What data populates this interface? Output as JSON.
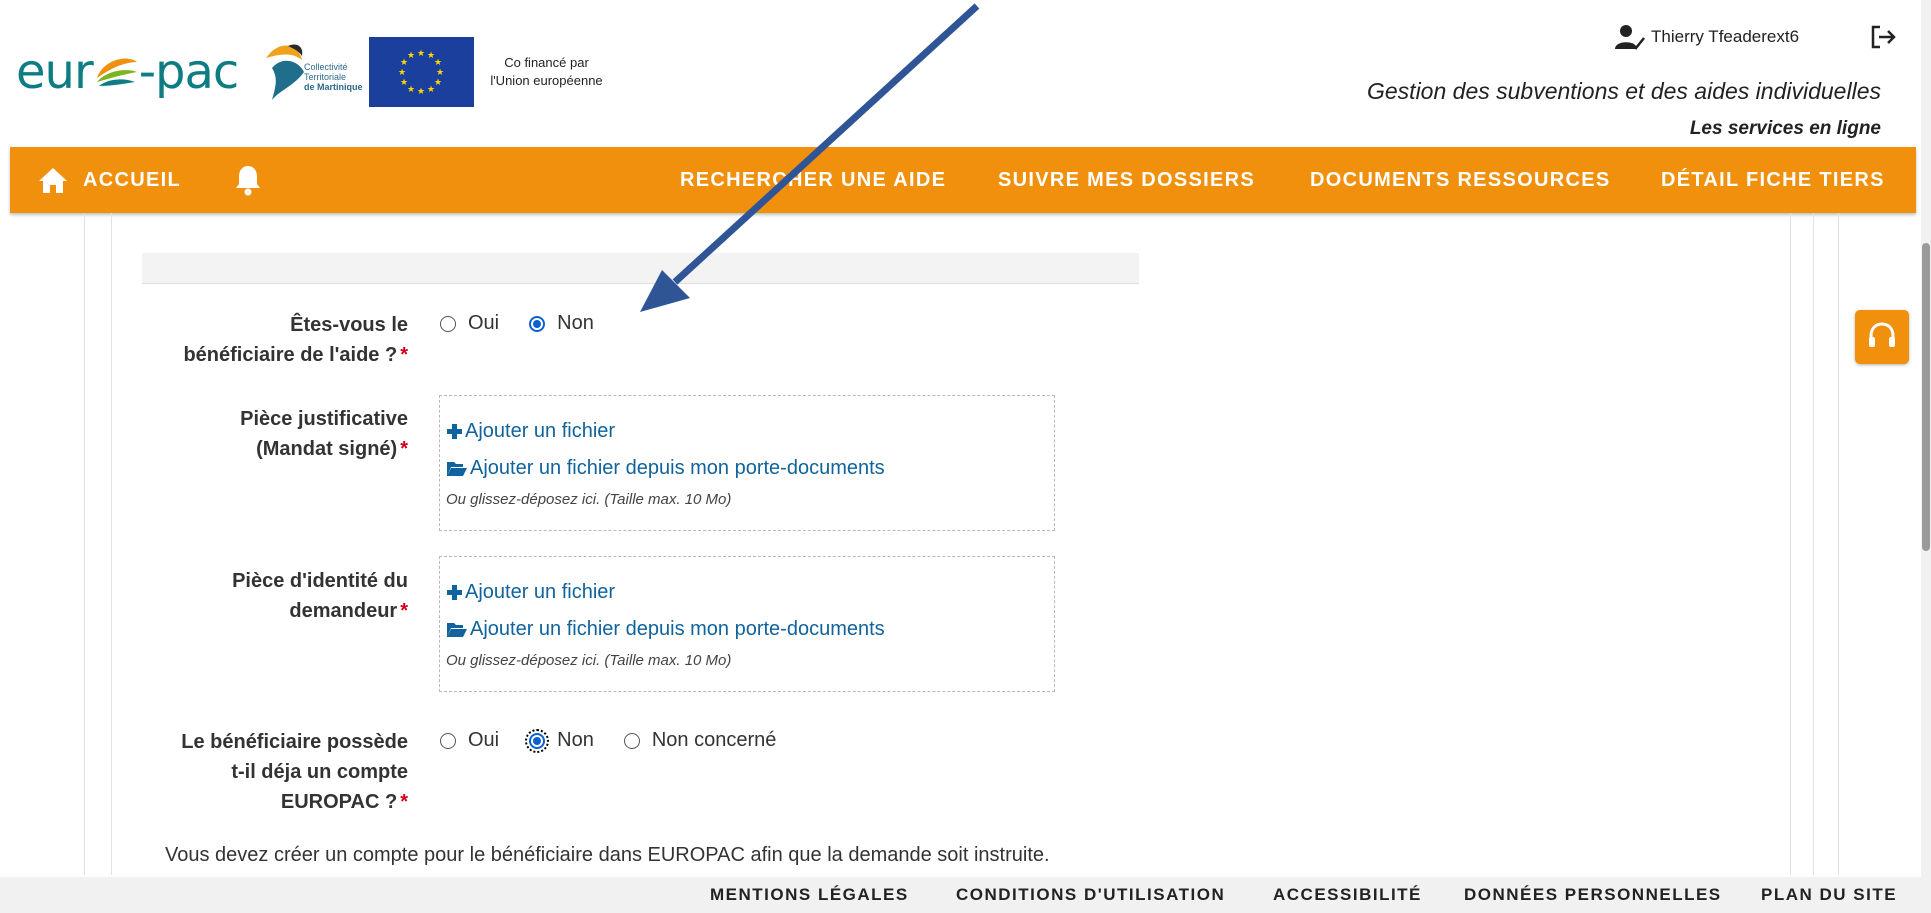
{
  "header": {
    "logo_left": "eur",
    "logo_right": "-pac",
    "ctm_lines": [
      "Collectivité",
      "Territoriale",
      "de Martinique"
    ],
    "eu_caption_line1": "Co financé par",
    "eu_caption_line2": "l'Union européenne",
    "user_name": "Thierry Tfeaderext6",
    "tagline": "Gestion des subventions et des aides individuelles",
    "services": "Les services en ligne"
  },
  "nav": {
    "home": "ACCUEIL",
    "search": "RECHERCHER UNE AIDE",
    "follow": "SUIVRE MES DOSSIERS",
    "docs": "DOCUMENTS RESSOURCES",
    "tiers": "DÉTAIL FICHE TIERS"
  },
  "form": {
    "q1": {
      "label_line1": "Êtes-vous le",
      "label_line2": "bénéficiaire de l'aide ?",
      "options": [
        "Oui",
        "Non"
      ],
      "selected": "Non"
    },
    "piece_mandat": {
      "label_line1": "Pièce justificative",
      "label_line2": "(Mandat signé)"
    },
    "piece_identite": {
      "label_line1": "Pièce d'identité du",
      "label_line2": "demandeur"
    },
    "upload": {
      "add_file": "Ajouter un fichier",
      "add_from_docs": "Ajouter un fichier depuis mon porte-documents",
      "hint": "Ou glissez-déposez ici. (Taille max. 10 Mo)"
    },
    "q2": {
      "label_line1": "Le bénéficiaire possède",
      "label_line2": "t-il déja un compte",
      "label_line3": "EUROPAC ?",
      "options": [
        "Oui",
        "Non",
        "Non concerné"
      ],
      "selected": "Non"
    },
    "required_mark": "*",
    "info": "Vous devez créer un compte pour le bénéficiaire dans EUROPAC afin que la demande soit instruite."
  },
  "footer": {
    "legal": "MENTIONS LÉGALES",
    "terms": "CONDITIONS D'UTILISATION",
    "access": "ACCESSIBILITÉ",
    "privacy": "DONNÉES PERSONNELLES",
    "sitemap": "PLAN DU SITE"
  },
  "colors": {
    "nav_orange": "#f0900c",
    "link_blue": "#10639c",
    "required_red": "#d0021b",
    "radio_blue": "#0a62d0",
    "annotation_arrow": "#2f5597"
  },
  "icons": [
    "home-icon",
    "bell-icon",
    "user-check-icon",
    "logout-icon",
    "plus-icon",
    "folder-open-icon",
    "headset-icon"
  ]
}
